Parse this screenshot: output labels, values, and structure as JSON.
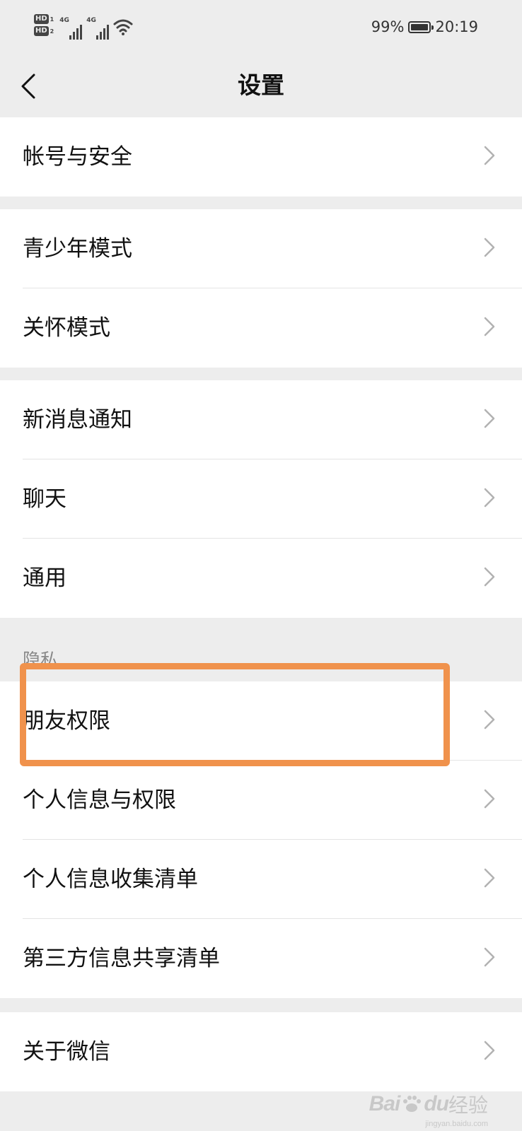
{
  "status_bar": {
    "hd1": "HD",
    "hd1_num": "1",
    "hd2": "HD",
    "hd2_num": "2",
    "network1": "4G",
    "network2": "4G",
    "battery_percent": "99%",
    "time": "20:19",
    "icons": [
      "hd-icon",
      "signal-icon",
      "wifi-icon",
      "battery-icon"
    ]
  },
  "nav": {
    "title": "设置",
    "back_icon": "chevron-left-icon"
  },
  "groups": [
    {
      "items": [
        {
          "label": "帐号与安全"
        }
      ]
    },
    {
      "items": [
        {
          "label": "青少年模式"
        },
        {
          "label": "关怀模式"
        }
      ]
    },
    {
      "items": [
        {
          "label": "新消息通知"
        },
        {
          "label": "聊天"
        },
        {
          "label": "通用"
        }
      ]
    },
    {
      "header": "隐私",
      "items": [
        {
          "label": "朋友权限"
        },
        {
          "label": "个人信息与权限"
        },
        {
          "label": "个人信息收集清单"
        },
        {
          "label": "第三方信息共享清单"
        }
      ]
    },
    {
      "items": [
        {
          "label": "关于微信"
        }
      ]
    }
  ],
  "highlight": {
    "color": "#f0924c",
    "target": "朋友权限"
  },
  "watermark": {
    "brand": "Bai",
    "brand2": "du",
    "suffix": "经验",
    "url": "jingyan.baidu.com"
  },
  "colors": {
    "background": "#ededed",
    "row": "#ffffff",
    "chevron": "#b2b2b2",
    "text": "#111111"
  }
}
